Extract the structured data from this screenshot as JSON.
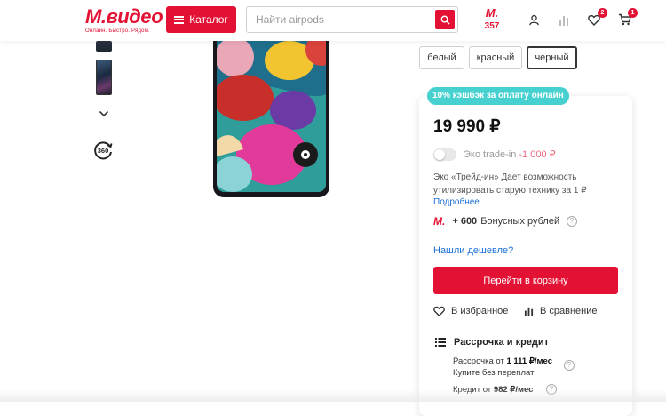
{
  "header": {
    "logo_text": "М.видео",
    "logo_tagline": "Онлайн. Быстро. Рядом.",
    "catalog_label": "Каталог",
    "search_placeholder": "Найти airpods",
    "bonus_mark": "М.",
    "bonus_count": "357",
    "favorites_badge": "2",
    "cart_badge": "1",
    "icons": [
      "menu-icon",
      "search-icon",
      "user-icon",
      "compare-icon",
      "heart-icon",
      "cart-icon"
    ]
  },
  "gallery": {
    "icons": [
      "chevron-down-icon",
      "view-360-icon"
    ],
    "rotate_label": "360"
  },
  "colors": {
    "options": [
      "белый",
      "красный",
      "черный"
    ],
    "selected": "черный"
  },
  "offer": {
    "cashback_label": "10% кэшбэк за оплату онлайн",
    "price": "19 990 ₽",
    "tradein_label": "Эко trade-in",
    "tradein_discount": "-1 000 ₽",
    "tradein_desc": "Эко «Трейд-ин» Дает возможность утилизировать старую технику за 1 ₽",
    "more_link": "Подробнее",
    "bonus_mark": "М.",
    "bonus_amount": "+ 600",
    "bonus_text": "Бонусных рублей",
    "cheaper_link": "Нашли дешевле?",
    "cart_button": "Перейти в корзину",
    "favorite_label": "В избранное",
    "compare_label": "В сравнение",
    "credit_title": "Рассрочка и кредит",
    "installment_prefix": "Рассрочка от",
    "installment_amount": "1 111 ₽/мес",
    "installment_note": "Купите без переплат",
    "credit_prefix": "Кредит от",
    "credit_amount": "982 ₽/мес",
    "help_mark": "?"
  },
  "colors_palette": {
    "brand_red": "#e31235",
    "cashback_teal": "#47d0d0",
    "link_blue": "#1a6fd4"
  }
}
